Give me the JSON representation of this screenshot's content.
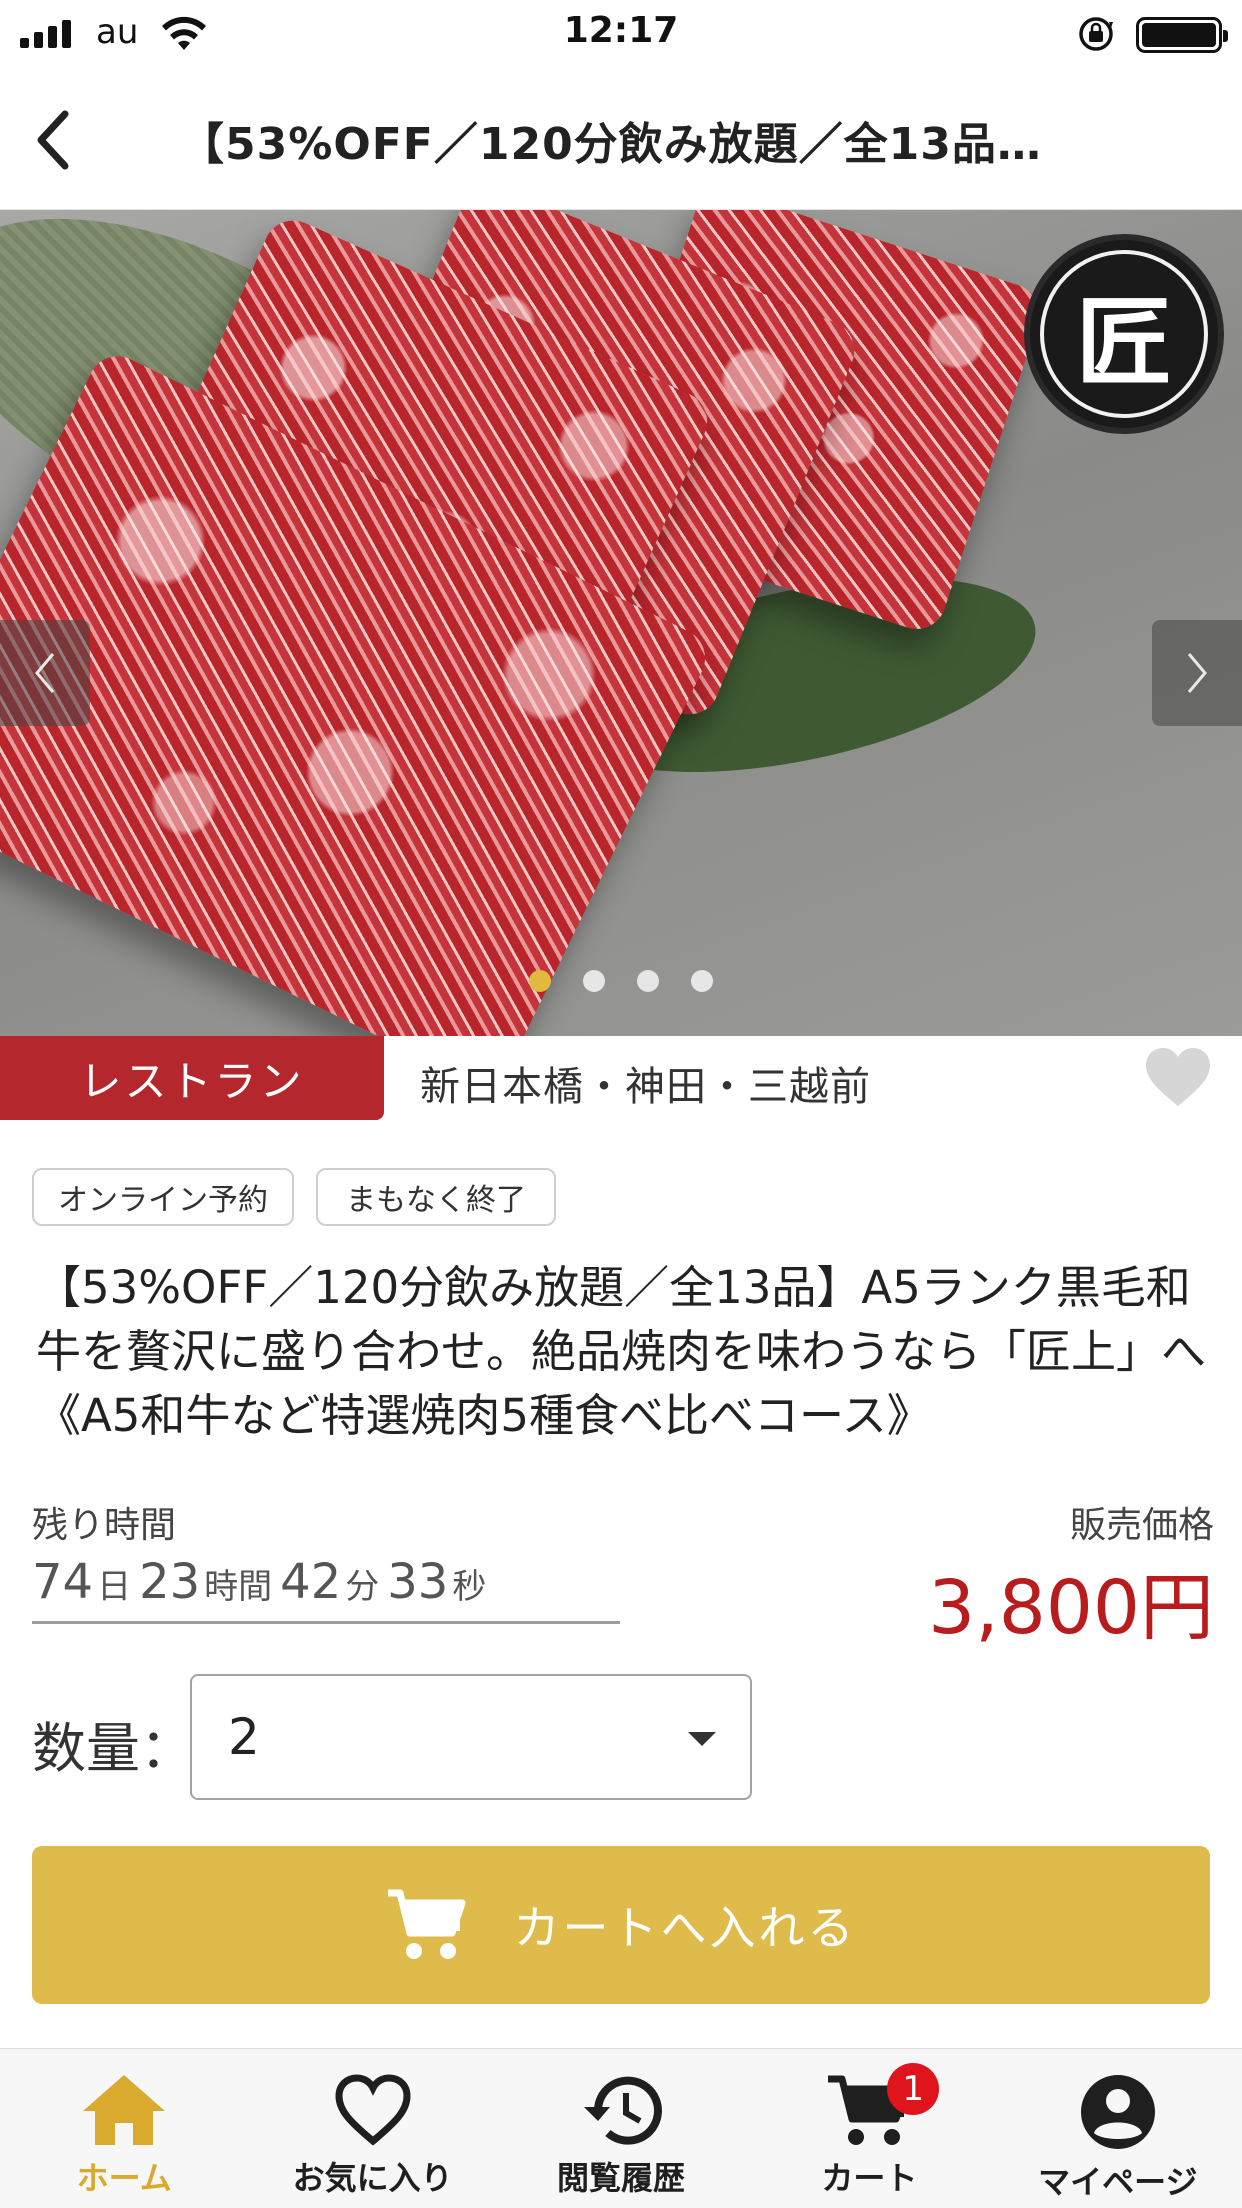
{
  "status_bar": {
    "carrier": "au",
    "time": "12:17"
  },
  "header": {
    "title": "【53%OFF／120分飲み放題／全13品…"
  },
  "hero": {
    "slide_count": 4,
    "active_slide": 1,
    "logo_text": "匠"
  },
  "category": {
    "label": "レストラン",
    "area": "新日本橋・神田・三越前"
  },
  "tags": [
    "オンライン予約",
    "まもなく終了"
  ],
  "deal": {
    "title": "【53%OFF／120分飲み放題／全13品】A5ランク黒毛和牛を贅沢に盛り合わせ。絶品焼肉を味わうなら「匠上」へ《A5和牛など特選焼肉5種食べ比べコース》"
  },
  "timer": {
    "label": "残り時間",
    "days": "74",
    "days_unit": "日",
    "hours": "23",
    "hours_unit": "時間",
    "minutes": "42",
    "minutes_unit": "分",
    "seconds": "33",
    "seconds_unit": "秒"
  },
  "price": {
    "label": "販売価格",
    "value": "3,800円"
  },
  "quantity": {
    "label": "数量：",
    "value": "2"
  },
  "cart_button": {
    "label": "カートへ入れる"
  },
  "bottom_nav": {
    "items": [
      {
        "label": "ホーム",
        "icon": "home-icon",
        "active": true
      },
      {
        "label": "お気に入り",
        "icon": "heart-icon"
      },
      {
        "label": "閲覧履歴",
        "icon": "history-icon"
      },
      {
        "label": "カート",
        "icon": "cart-icon",
        "badge": "1"
      },
      {
        "label": "マイページ",
        "icon": "account-icon"
      }
    ]
  },
  "colors": {
    "accent": "#dfbb4c",
    "category_red": "#b3272d",
    "price_red": "#b81c1c",
    "badge_red": "#e0141c"
  }
}
